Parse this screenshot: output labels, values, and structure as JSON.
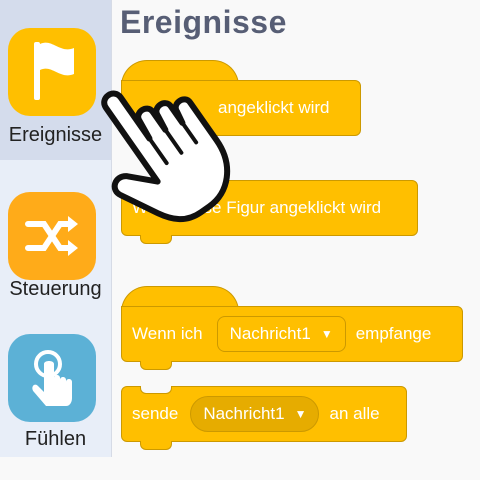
{
  "sidebar": {
    "categories": [
      {
        "label": "Ereignisse",
        "color": "#ffbf00",
        "icon": "flag-icon"
      },
      {
        "label": "Steuerung",
        "color": "#ffab19",
        "icon": "shuffle-icon"
      },
      {
        "label": "Fühlen",
        "color": "#5cb1d6",
        "icon": "touch-icon"
      }
    ]
  },
  "palette": {
    "title": "Ereignisse",
    "blocks": {
      "flag_clicked": "angeklickt wird",
      "sprite_clicked": "Wenn diese Figur angeklickt wird",
      "receive_prefix": "Wenn ich",
      "receive_message": "Nachricht1",
      "receive_suffix": "empfange",
      "broadcast_prefix": "sende",
      "broadcast_message": "Nachricht1",
      "broadcast_suffix": "an alle"
    }
  },
  "colors": {
    "events": "#ffbf00",
    "events_border": "#cc9900",
    "title_text": "#575e75"
  }
}
